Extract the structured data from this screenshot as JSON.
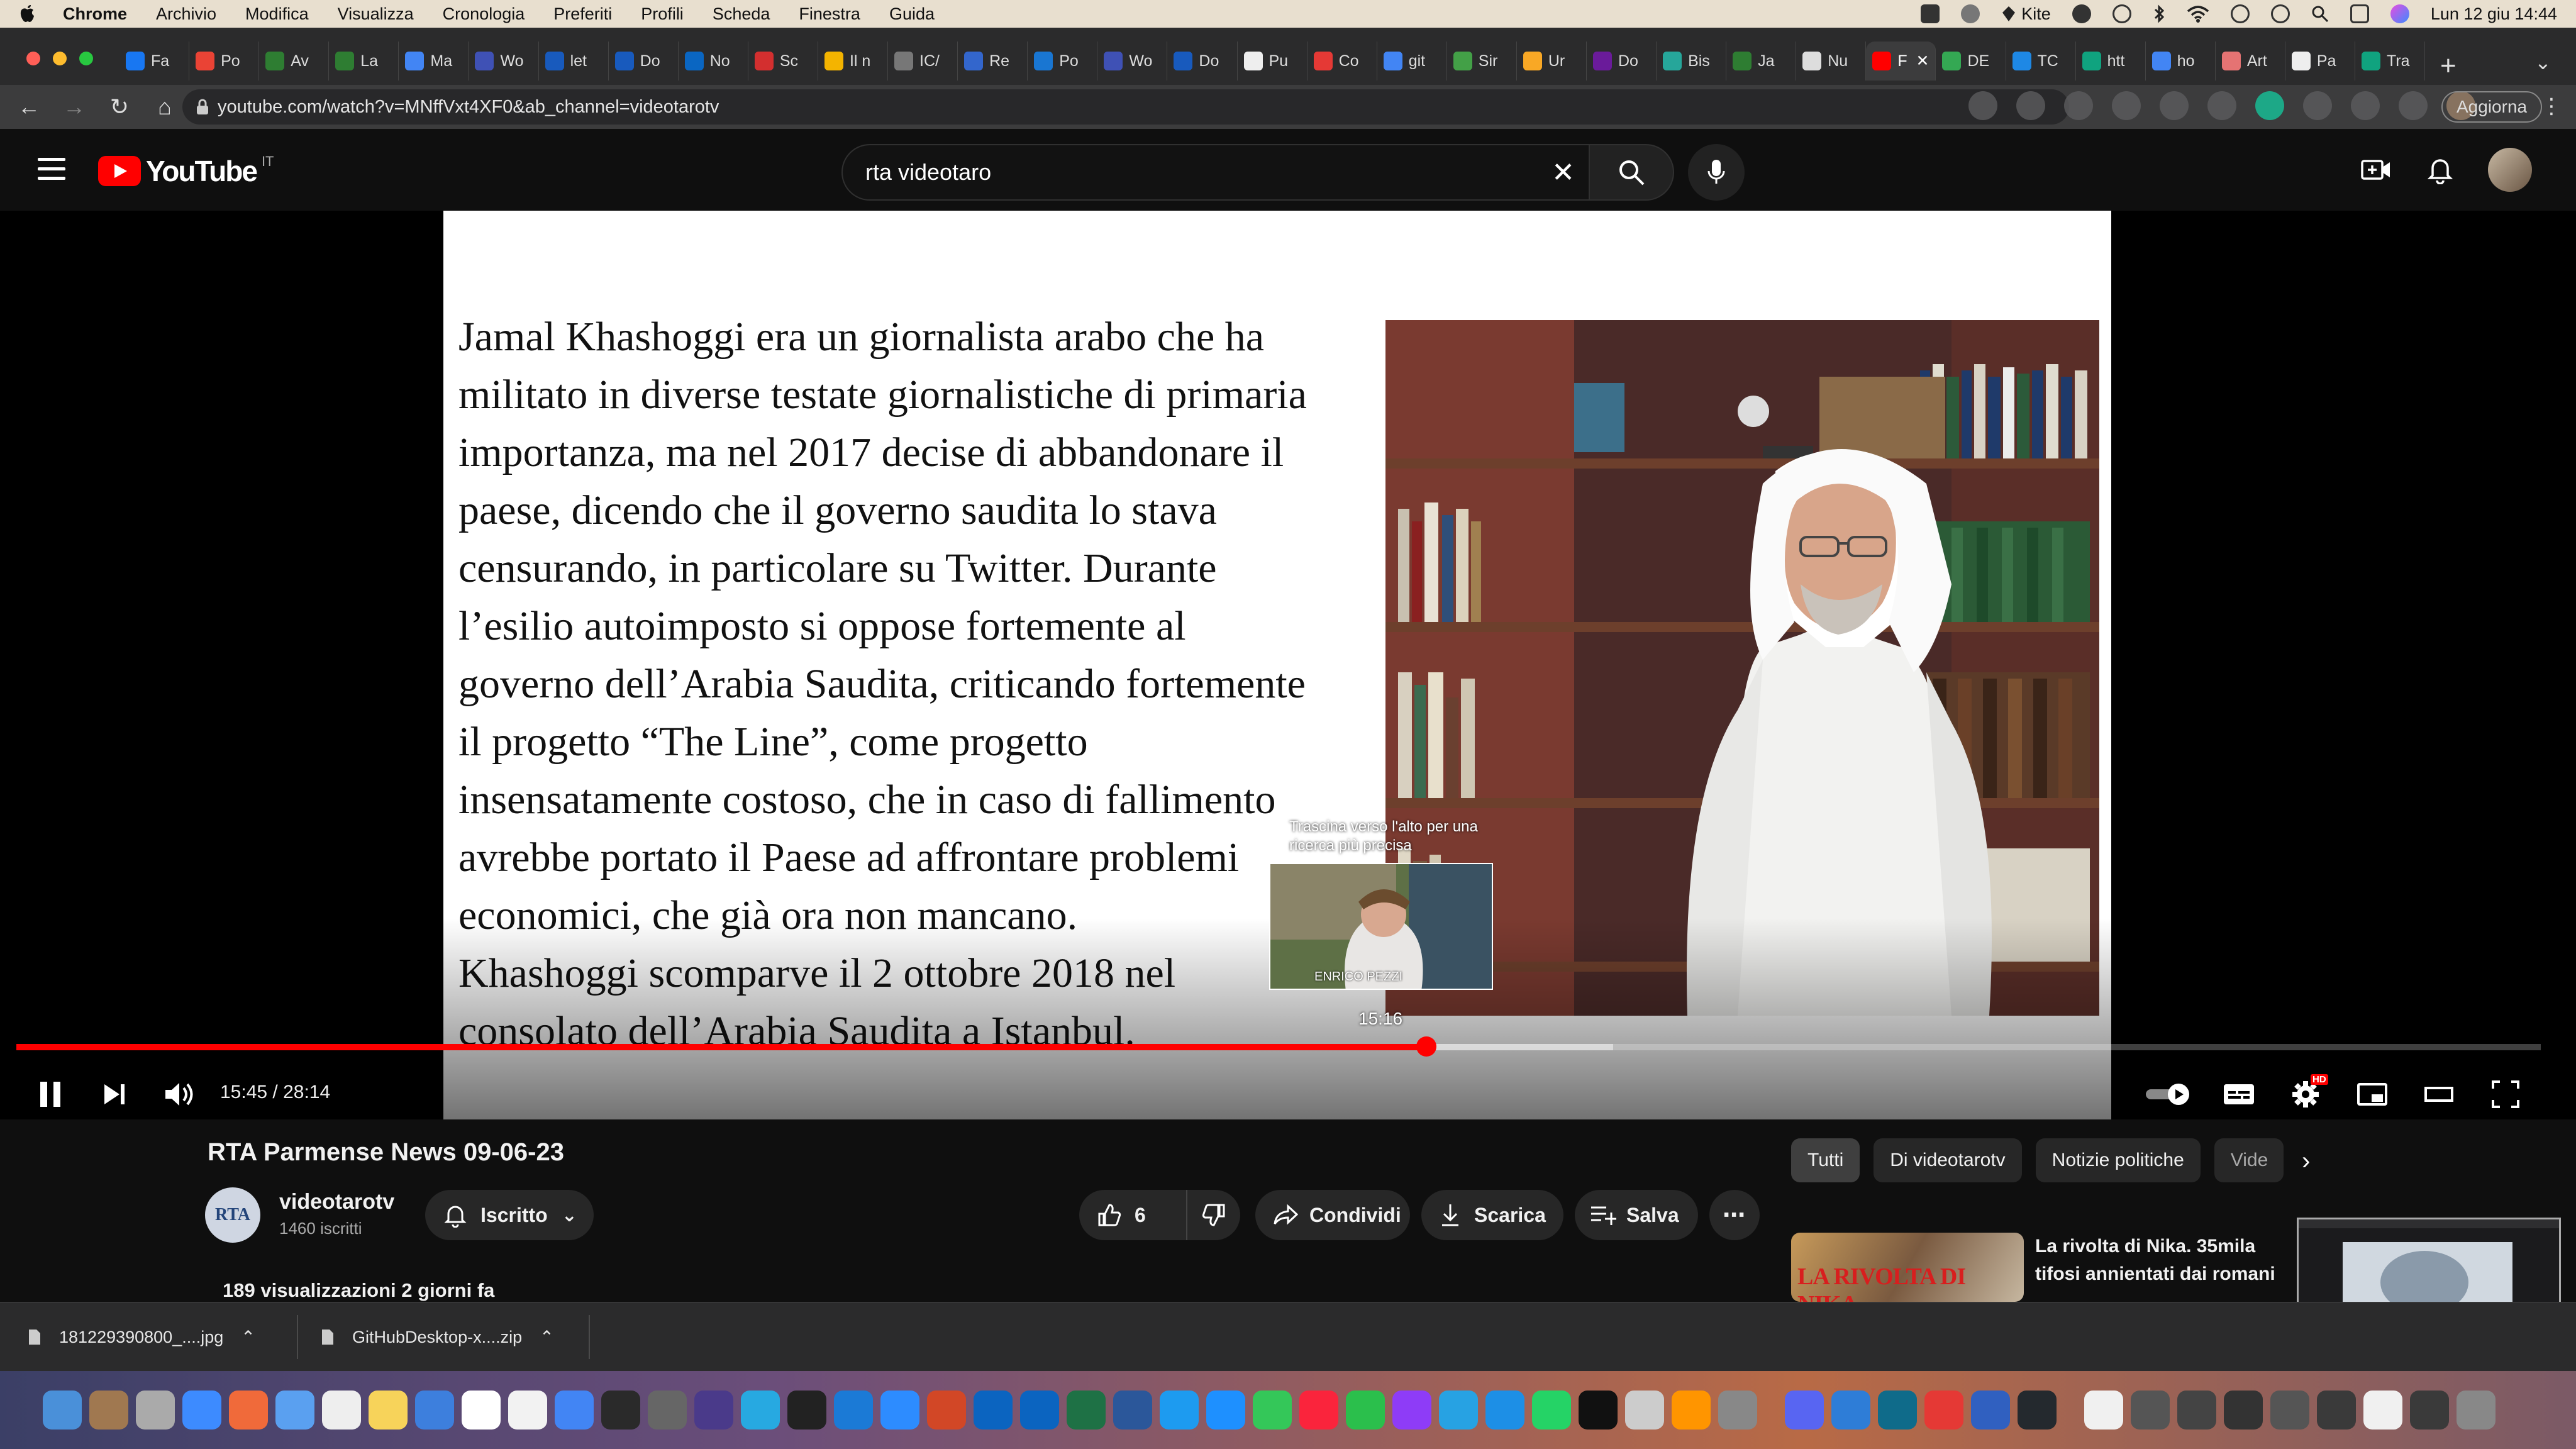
{
  "menubar": {
    "app": "Chrome",
    "items": [
      "Archivio",
      "Modifica",
      "Visualizza",
      "Cronologia",
      "Preferiti",
      "Profili",
      "Scheda",
      "Finestra",
      "Guida"
    ],
    "kite": "Kite",
    "clock": "Lun 12 giu  14:44"
  },
  "tabs": [
    {
      "label": "Fa",
      "color": "#1877f2"
    },
    {
      "label": "Po",
      "color": "#ea4335"
    },
    {
      "label": "Av",
      "color": "#2e7d32"
    },
    {
      "label": "La",
      "color": "#2e7d32"
    },
    {
      "label": "Ma",
      "color": "#4285f4"
    },
    {
      "label": "Wo",
      "color": "#3f51b5"
    },
    {
      "label": "let",
      "color": "#185abd"
    },
    {
      "label": "Do",
      "color": "#185abd"
    },
    {
      "label": "No",
      "color": "#0a66c2"
    },
    {
      "label": "Sc",
      "color": "#d32f2f"
    },
    {
      "label": "Il n",
      "color": "#f4b400"
    },
    {
      "label": "IC/",
      "color": "#777777"
    },
    {
      "label": "Re",
      "color": "#3366cc"
    },
    {
      "label": "Po",
      "color": "#1976d2"
    },
    {
      "label": "Wo",
      "color": "#3f51b5"
    },
    {
      "label": "Do",
      "color": "#185abd"
    },
    {
      "label": "Pu",
      "color": "#eeeeee"
    },
    {
      "label": "Co",
      "color": "#e53935"
    },
    {
      "label": "git",
      "color": "#4285f4"
    },
    {
      "label": "Sir",
      "color": "#43a047"
    },
    {
      "label": "Ur",
      "color": "#f9a825"
    },
    {
      "label": "Do",
      "color": "#6a1b9a"
    },
    {
      "label": "Bis",
      "color": "#26a69a"
    },
    {
      "label": "Ja",
      "color": "#2e7d32"
    },
    {
      "label": "Nu",
      "color": "#dddddd"
    },
    {
      "label": "F",
      "color": "#ff0000"
    },
    {
      "label": "DE",
      "color": "#34a853"
    },
    {
      "label": "TC",
      "color": "#1e88e5"
    },
    {
      "label": "htt",
      "color": "#10a37f"
    },
    {
      "label": "ho",
      "color": "#4285f4"
    },
    {
      "label": "Art",
      "color": "#e57373"
    },
    {
      "label": "Pa",
      "color": "#eeeeee"
    },
    {
      "label": "Tra",
      "color": "#10a37f"
    }
  ],
  "active_tab": 25,
  "url": "youtube.com/watch?v=MNffVxt4XF0&ab_channel=videotarotv",
  "update_label": "Aggiorna",
  "youtube": {
    "logo_text": "YouTube",
    "country": "IT",
    "search_value": "rta videotaro"
  },
  "video": {
    "article": [
      "Jamal Khashoggi era un giornalista arabo che ha",
      "militato in diverse testate giornalistiche di primaria",
      "importanza, ma nel 2017 decise di abbandonare il",
      "paese, dicendo che il governo saudita lo stava",
      "censurando, in particolare su Twitter. Durante",
      "l’esilio autoimposto si oppose fortemente al",
      "governo dell’Arabia Saudita, criticando fortemente",
      "il progetto “The Line”, come progetto",
      "insensatamente costoso, che in caso di fallimento",
      "avrebbe portato il Paese ad affrontare problemi",
      "economici, che già ora non mancano.",
      "Khashoggi scomparve il 2 ottobre 2018 nel",
      "consolato dell’Arabia Saudita a Istanbul."
    ],
    "preview_hint": "Trascina verso l'alto per una ricerca più precisa",
    "preview_caption": "ENRICO PEZZI",
    "preview_time": "15:16",
    "time_display": "15:45 / 28:14",
    "played_fraction": 0.5586,
    "buffered_fraction": 0.6326,
    "hd_badge": "HD"
  },
  "details": {
    "title": "RTA Parmense News 09-06-23",
    "channel": "videotarotv",
    "channel_logo": "RTA",
    "subscribers": "1460 iscritti",
    "subscribe_label": "Iscritto",
    "likes": "6",
    "share_label": "Condividi",
    "download_label": "Scarica",
    "save_label": "Salva",
    "stats": "189 visualizzazioni  2 giorni fa"
  },
  "chips": [
    "Tutti",
    "Di videotarotv",
    "Notizie politiche",
    "Vide"
  ],
  "recommended": {
    "thumb_text": "LA RIVOLTA DI NIKA",
    "title": "La rivolta di Nika. 35mila tifosi annientati dai romani"
  },
  "downloads": [
    {
      "name": "181229390800_....jpg"
    },
    {
      "name": "GitHubDesktop-x....zip"
    }
  ],
  "dock_colors": [
    "#4a90d9",
    "#a07850",
    "#aaaaaa",
    "#3d8bff",
    "#f06a3a",
    "#5aa0f0",
    "#eeeeee",
    "#f7d35a",
    "#3d7fdd",
    "#ffffff",
    "#f2f2f2",
    "#4285f4",
    "#2a2a2a",
    "#666666",
    "#4a3a8a",
    "#27a9e1",
    "#222222",
    "#1b7ad6",
    "#2d8cff",
    "#d24726",
    "#0b64c0",
    "#0b64c0",
    "#1e7145",
    "#2b579a",
    "#1d9bf0",
    "#1e90ff",
    "#34c759",
    "#fa243c",
    "#2bbf4c",
    "#8e3cf7",
    "#27a2e3",
    "#1d8fe6",
    "#25d366",
    "#111111",
    "#cccccc",
    "#ff9500",
    "#888888",
    "#5865f2",
    "#2e7dd7",
    "#0f6b8a",
    "#e53935",
    "#3060c0",
    "#24292e",
    "#f0f0f0",
    "#555555",
    "#444444",
    "#333333",
    "#555555",
    "#3a3a3a",
    "#f0f0f0",
    "#3a3a3a",
    "#888888"
  ]
}
